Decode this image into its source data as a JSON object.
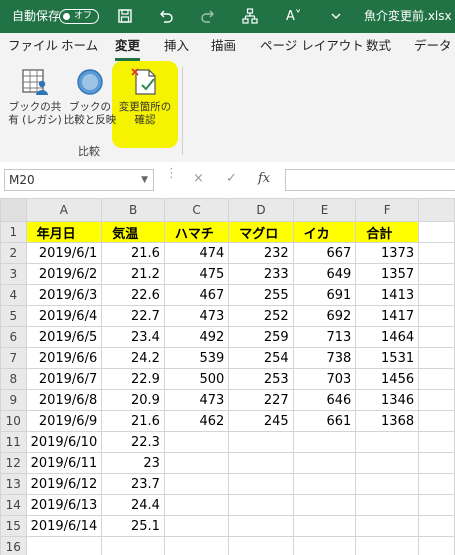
{
  "titlebar": {
    "autosave_label": "自動保存",
    "autosave_toggle": "オフ",
    "filename": "魚介変更前.xlsx",
    "font_size_icon": "A˅"
  },
  "tabs": [
    "ファイル",
    "ホーム",
    "変更",
    "挿入",
    "描画",
    "ページ レイアウト",
    "数式",
    "データ"
  ],
  "ribbon": {
    "share_workbook": [
      "ブックの共",
      "有 (レガシ)"
    ],
    "compare_merge": [
      "ブックの",
      "比較と反映"
    ],
    "track_changes": [
      "変更箇所の",
      "確認"
    ],
    "group_label": "比較"
  },
  "formula_bar": {
    "name_box": "M20",
    "cancel_symbol": "×",
    "enter_symbol": "✓",
    "fx_label": "fx",
    "value": ""
  },
  "sheet": {
    "columns": [
      "A",
      "B",
      "C",
      "D",
      "E",
      "F"
    ],
    "header": [
      "年月日",
      "気温",
      "ハマチ",
      "マグロ",
      "イカ",
      "合計"
    ],
    "rows": [
      [
        "2019/6/1",
        "21.6",
        "474",
        "232",
        "667",
        "1373"
      ],
      [
        "2019/6/2",
        "21.2",
        "475",
        "233",
        "649",
        "1357"
      ],
      [
        "2019/6/3",
        "22.6",
        "467",
        "255",
        "691",
        "1413"
      ],
      [
        "2019/6/4",
        "22.7",
        "473",
        "252",
        "692",
        "1417"
      ],
      [
        "2019/6/5",
        "23.4",
        "492",
        "259",
        "713",
        "1464"
      ],
      [
        "2019/6/6",
        "24.2",
        "539",
        "254",
        "738",
        "1531"
      ],
      [
        "2019/6/7",
        "22.9",
        "500",
        "253",
        "703",
        "1456"
      ],
      [
        "2019/6/8",
        "20.9",
        "473",
        "227",
        "646",
        "1346"
      ],
      [
        "2019/6/9",
        "21.6",
        "462",
        "245",
        "661",
        "1368"
      ],
      [
        "2019/6/10",
        "22.3",
        "",
        "",
        "",
        ""
      ],
      [
        "2019/6/11",
        "23",
        "",
        "",
        "",
        ""
      ],
      [
        "2019/6/12",
        "23.7",
        "",
        "",
        "",
        ""
      ],
      [
        "2019/6/13",
        "24.4",
        "",
        "",
        "",
        ""
      ],
      [
        "2019/6/14",
        "25.1",
        "",
        "",
        "",
        ""
      ],
      [
        "",
        "",
        "",
        "",
        "",
        ""
      ]
    ]
  }
}
